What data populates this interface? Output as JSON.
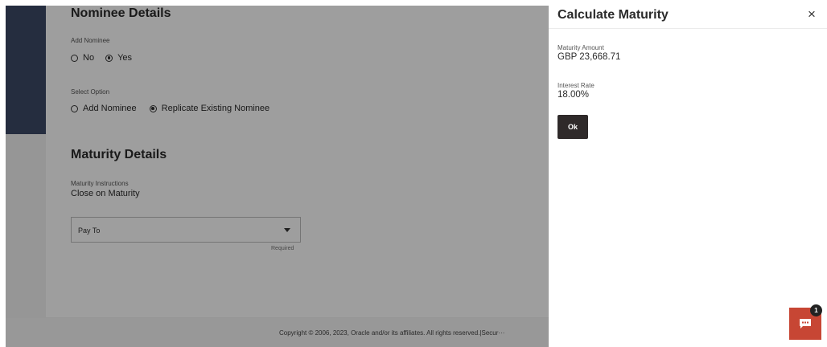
{
  "nominee": {
    "title": "Nominee Details",
    "add_label": "Add Nominee",
    "options": {
      "no": "No",
      "yes": "Yes"
    },
    "selected": "Yes",
    "select_option_label": "Select Option",
    "select_options": {
      "add": "Add Nominee",
      "replicate": "Replicate Existing Nominee"
    },
    "select_selected": "Replicate Existing Nominee"
  },
  "maturity": {
    "title": "Maturity Details",
    "instructions_label": "Maturity Instructions",
    "instructions_value": "Close on Maturity",
    "pay_to_placeholder": "Pay To",
    "required_text": "Required"
  },
  "footer": {
    "text": "Copyright © 2006, 2023, Oracle and/or its affiliates. All rights reserved.|Secur···"
  },
  "panel": {
    "title": "Calculate Maturity",
    "close_glyph": "×",
    "maturity_amount_label": "Maturity Amount",
    "maturity_amount_value": "GBP 23,668.71",
    "interest_rate_label": "Interest Rate",
    "interest_rate_value": "18.00%",
    "ok_label": "Ok"
  },
  "chat": {
    "badge_count": "1",
    "icon": "chat-icon",
    "color": "#c74634"
  }
}
